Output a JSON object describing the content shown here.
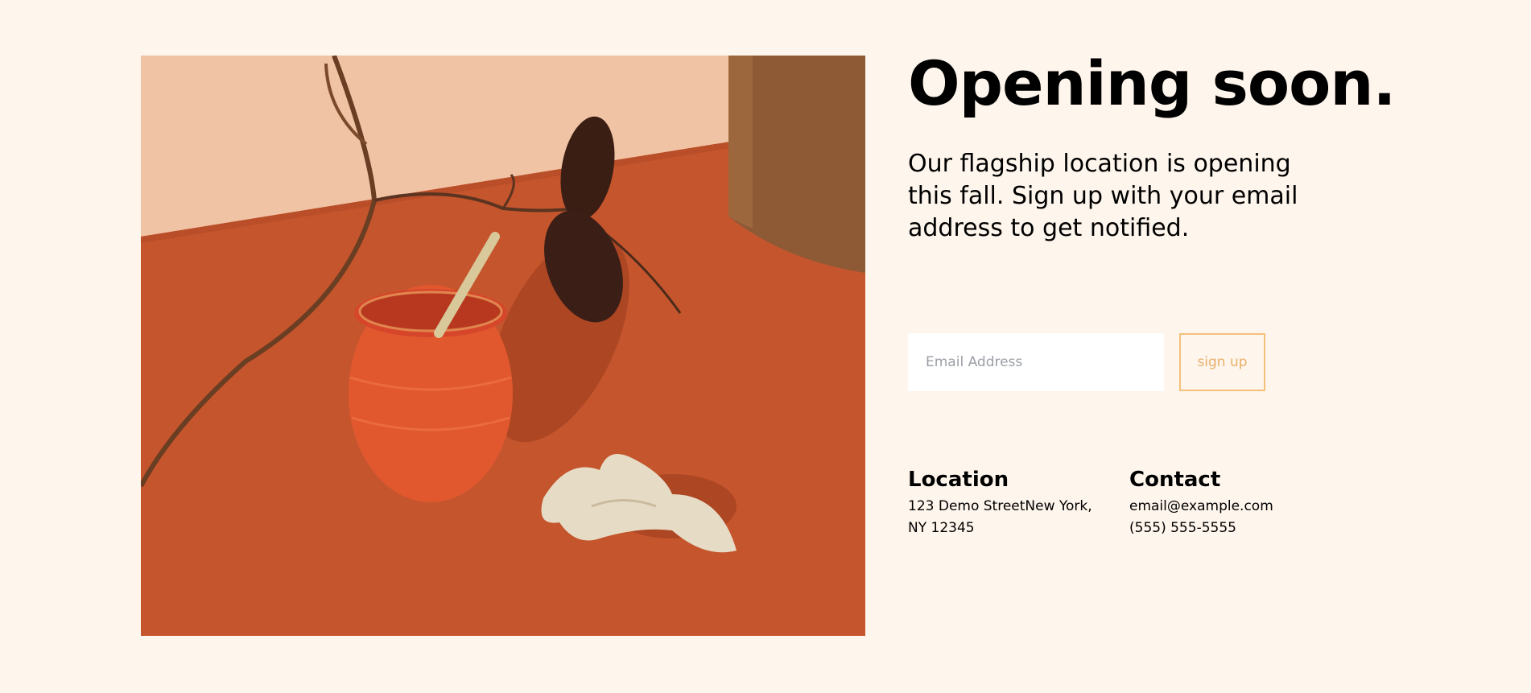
{
  "hero": {
    "image_alt": "Glass of red juice with a straw, a ginger root and a leafy branch on an orange tabletop"
  },
  "main": {
    "headline": "Opening soon.",
    "intro": "Our flagship location is opening this fall. Sign up with your email address to get notified."
  },
  "signup": {
    "email_placeholder": "Email Address",
    "button_label": "sign up"
  },
  "location": {
    "heading": "Location",
    "address": "123 Demo StreetNew York, NY 12345"
  },
  "contact": {
    "heading": "Contact",
    "email": "email@example.com",
    "phone": "(555) 555-5555"
  },
  "colors": {
    "background": "#fef5ec",
    "accent": "#f3c17a",
    "photo_table": "#c8582f"
  }
}
